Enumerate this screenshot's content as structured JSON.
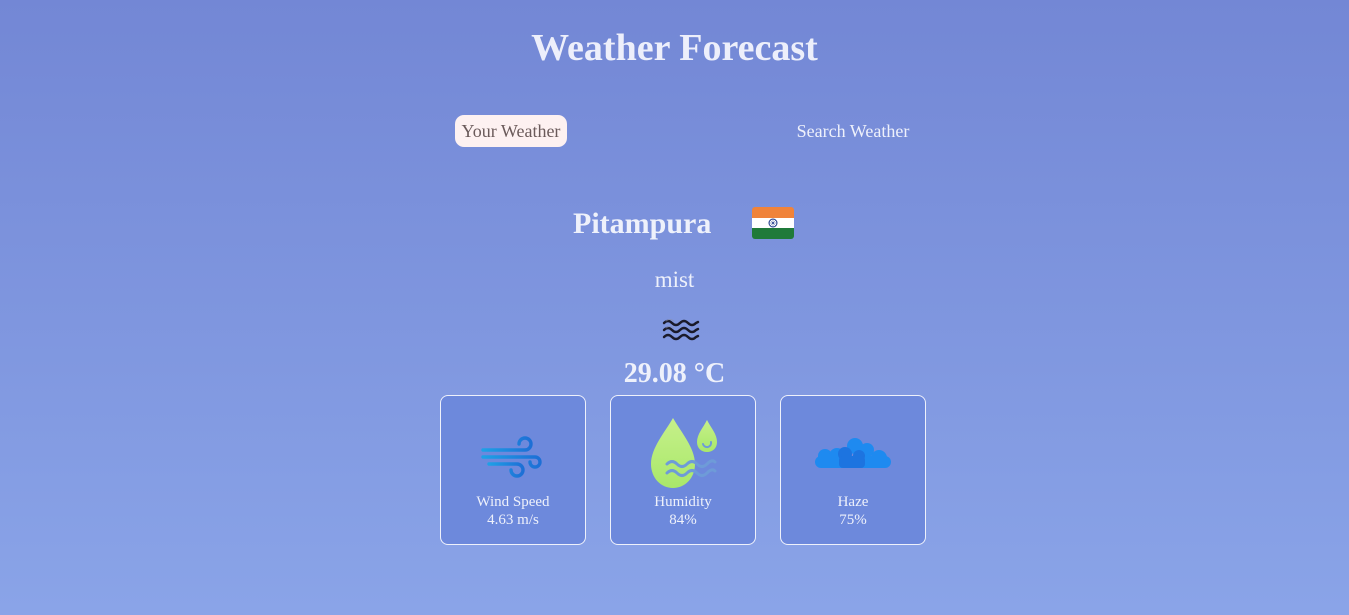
{
  "header": {
    "title": "Weather Forecast"
  },
  "tabs": [
    {
      "label": "Your Weather",
      "active": true
    },
    {
      "label": "Search Weather",
      "active": false
    }
  ],
  "location": {
    "city": "Pitampura",
    "country_flag_icon": "india-flag-icon"
  },
  "weather": {
    "condition": "mist",
    "condition_icon": "mist-icon",
    "temperature": "29.08 °C"
  },
  "cards": [
    {
      "label": "Wind Speed",
      "value": "4.63 m/s",
      "icon": "wind-icon"
    },
    {
      "label": "Humidity",
      "value": "84%",
      "icon": "humidity-icon"
    },
    {
      "label": "Haze",
      "value": "75%",
      "icon": "cloud-icon"
    }
  ],
  "colors": {
    "background_top": "#7387d5",
    "background_bottom": "#8aa4e8",
    "card_background": "#6d89dc",
    "active_tab_background": "#fdf1f1",
    "active_tab_text": "#6a5a5a",
    "text": "#eef1fb"
  }
}
